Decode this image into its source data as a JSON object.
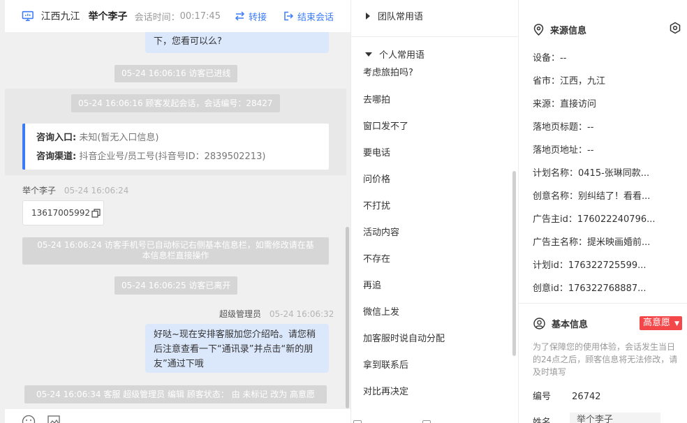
{
  "chat": {
    "header": {
      "location": "江西九江",
      "visitor_name": "举个李子",
      "time_label": "会话时间：",
      "time_value": "00:17:45",
      "transfer_label": "转接",
      "end_label": "结束会话"
    },
    "messages": {
      "partial_bubble": "下，您看可以么?",
      "sys_enter": "05-24 16:06:16 访客已进线",
      "sys_start": "05-24 16:06:16 顾客发起会话，会话编号：28427",
      "entry_key": "咨询入口:",
      "entry_value": "未知(暂无入口信息)",
      "channel_key": "咨询渠道:",
      "channel_value": "抖音企业号/员工号(抖音号ID：2839502213)",
      "visitor_meta_name": "举个李子",
      "visitor_meta_time": "05-24 16:06:24",
      "phone": "13617005992",
      "sys_phone_line1": "05-24 16:06:24 访客手机号已自动标记右侧基本信息栏，如需修改请在基",
      "sys_phone_line2": "本信息栏直接操作",
      "sys_leave": "05-24 16:06:25 访客已离开",
      "agent_meta_name": "超级管理员",
      "agent_meta_time": "05-24 16:06:32",
      "agent_bubble_line1": "好哒~现在安排客服加您介绍哈。请您稍",
      "agent_bubble_line2": "后注意查看一下“通讯录”并点击“新的朋",
      "agent_bubble_line3": "友”通过下哦",
      "sys_status": "05-24 16:06:34 客服 超级管理员 编辑 顾客状态： 由 未标记 改为 高意愿"
    }
  },
  "replies": {
    "team_group": "团队常用语",
    "personal_group": "个人常用语",
    "items": [
      "考虑旅拍吗?",
      "去哪拍",
      "窗口发不了",
      "要电话",
      "问价格",
      "不打扰",
      "活动内容",
      "不存在",
      "再追",
      "微信上发",
      "加客服时说自动分配",
      "拿到联系后",
      "对比再决定"
    ]
  },
  "info": {
    "source_title": "来源信息",
    "source_rows": [
      "设备：--",
      "省市：江西，九江",
      "来源：直接访问",
      "落地页标题：--",
      "落地页地址：--",
      "计划名称：0415-张琳同款...",
      "创意名称：别纠结了！看看...",
      "广告主id：176022240796...",
      "广告主名称：提米映画婚前...",
      "计划id：176322725599...",
      "创意id：176322768887..."
    ],
    "basic_title": "基本信息",
    "intent_badge": "高意愿",
    "notice": "为了保障您的使用体验，会话发生当日的24点之后，顾客信息将无法修改，请及时填写",
    "serial_label": "编号",
    "serial_value": "26742",
    "name_label": "姓名",
    "name_value": "举个李子"
  },
  "colors": {
    "accent": "#3b7cf6",
    "badge": "#f4474a",
    "system_msg_bg": "#d6d6d6",
    "agent_bubble_bg": "#dbe7fb"
  },
  "icons": [
    "monitor-icon",
    "transfer-icon",
    "exit-icon",
    "copy-icon",
    "settings-icon",
    "location-pin-icon",
    "user-circle-icon",
    "emoji-icon",
    "image-icon"
  ]
}
